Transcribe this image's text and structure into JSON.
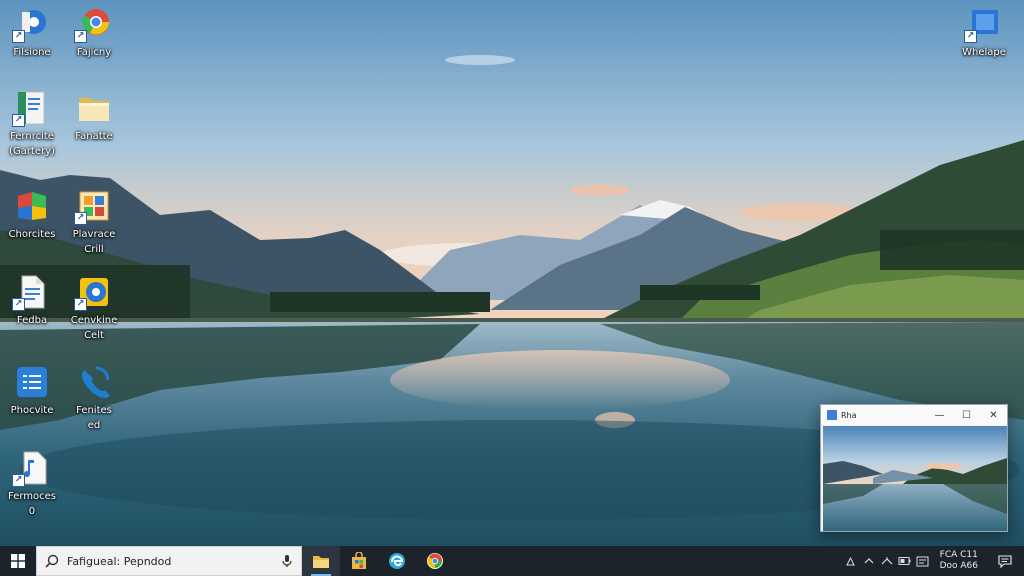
{
  "desktop": {
    "icons": [
      {
        "label": "Filsione",
        "icon": "disc-app-icon",
        "color": "#2a74d4"
      },
      {
        "label": "Fajicny",
        "icon": "chrome-icon",
        "color": "#dd4b39"
      },
      {
        "label": "Fernrcite\n(Gartery)",
        "icon": "notebook-icon",
        "color": "#2a8f5a"
      },
      {
        "label": "Fanatte",
        "icon": "folder-icon",
        "color": "#e8b84a"
      },
      {
        "label": "Chorcites",
        "icon": "colored-blocks-icon",
        "color": "#d94a3d"
      },
      {
        "label": "Plavrace\nCrill",
        "icon": "control-panel-icon",
        "color": "#f0a02a"
      },
      {
        "label": "Fedba",
        "icon": "document-icon",
        "color": "#3a7fd6"
      },
      {
        "label": "Cenvkine\nCelt",
        "icon": "chrome-blue-icon",
        "color": "#2a74d4"
      },
      {
        "label": "Phocvite",
        "icon": "checklist-icon",
        "color": "#2a7fd6"
      },
      {
        "label": "Fenites\ned",
        "icon": "phone-icon",
        "color": "#1e7fd0"
      },
      {
        "label": "Fermoces\n0",
        "icon": "music-file-icon",
        "color": "#2a74d4"
      },
      {
        "label": "Whelape",
        "icon": "window-app-icon",
        "color": "#2a74d4"
      }
    ]
  },
  "thumb_window": {
    "title": "Rha",
    "minimize": "—",
    "maximize": "☐",
    "close": "✕"
  },
  "taskbar": {
    "search_value": "Fafigueal: Pepndod",
    "apps": [
      {
        "name": "file-explorer-icon",
        "color": "#e8b84a"
      },
      {
        "name": "store-icon",
        "color": "#e8b84a"
      },
      {
        "name": "edge-icon",
        "color": "#2fa6e0"
      },
      {
        "name": "chrome-icon",
        "color": "#3bab4a"
      }
    ],
    "clock_time": "FCA C11",
    "clock_date": "Doo A66"
  }
}
